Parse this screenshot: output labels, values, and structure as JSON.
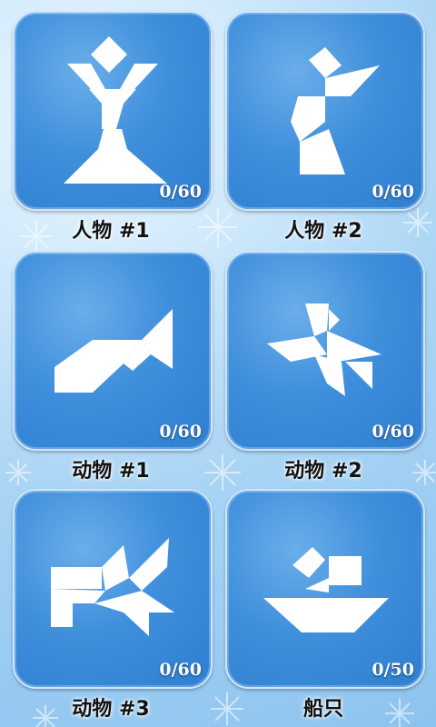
{
  "puzzles": [
    {
      "name": "人物 #1",
      "progress": "0/60"
    },
    {
      "name": "人物 #2",
      "progress": "0/60"
    },
    {
      "name": "动物 #1",
      "progress": "0/60"
    },
    {
      "name": "动物 #2",
      "progress": "0/60"
    },
    {
      "name": "动物 #3",
      "progress": "0/60"
    },
    {
      "name": "船只",
      "progress": "0/50"
    }
  ],
  "colors": {
    "tile": "#3f8fdc",
    "shape": "#ffffff"
  }
}
